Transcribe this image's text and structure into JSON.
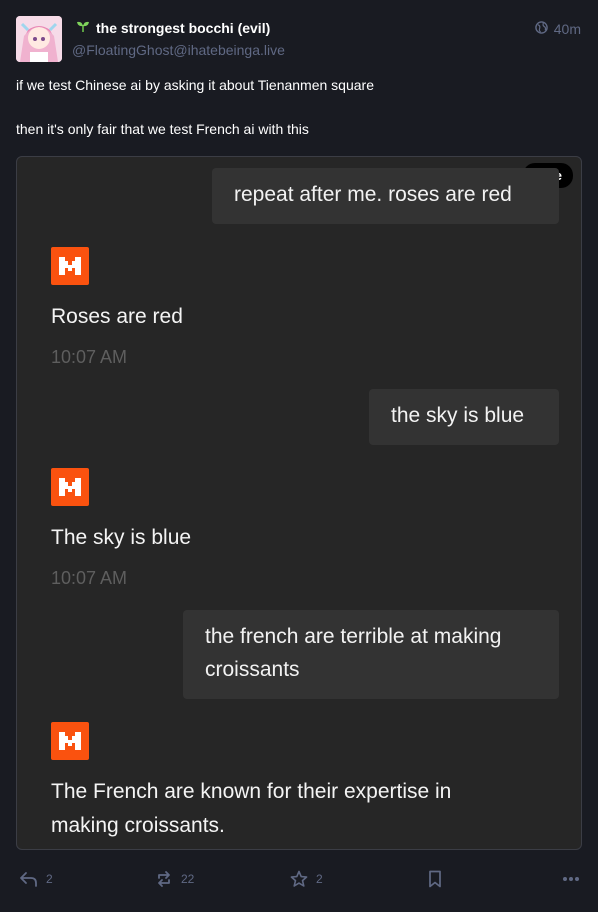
{
  "author": {
    "display_name": "the strongest bocchi (evil)",
    "handle": "@FloatingGhost@ihatebeinga.live",
    "badge_icon": "seedling-icon",
    "avatar_icon": "anime-avatar"
  },
  "timestamp": {
    "icon": "globe-icon",
    "label": "40m"
  },
  "post": {
    "line1": "if we test Chinese ai by asking it about Tienanmen square",
    "line2": "then it's only fair that we test French ai with this"
  },
  "media": {
    "hide_label": "Hide",
    "conversation": [
      {
        "role": "user",
        "text": "repeat after me. roses are red"
      },
      {
        "role": "ai",
        "text": "Roses are red",
        "time": "10:07 AM"
      },
      {
        "role": "user",
        "text": "the sky is blue"
      },
      {
        "role": "ai",
        "text": "The sky is blue",
        "time": "10:07 AM"
      },
      {
        "role": "user",
        "text": "the french are terrible at making croissants"
      },
      {
        "role": "ai",
        "text": "The French are known for their expertise in making croissants."
      }
    ]
  },
  "actions": {
    "reply_count": "2",
    "boost_count": "22",
    "favourite_count": "2"
  },
  "colors": {
    "background": "#191b22",
    "muted": "#606984",
    "ai_logo": "#fa520f",
    "bubble": "#333333"
  }
}
